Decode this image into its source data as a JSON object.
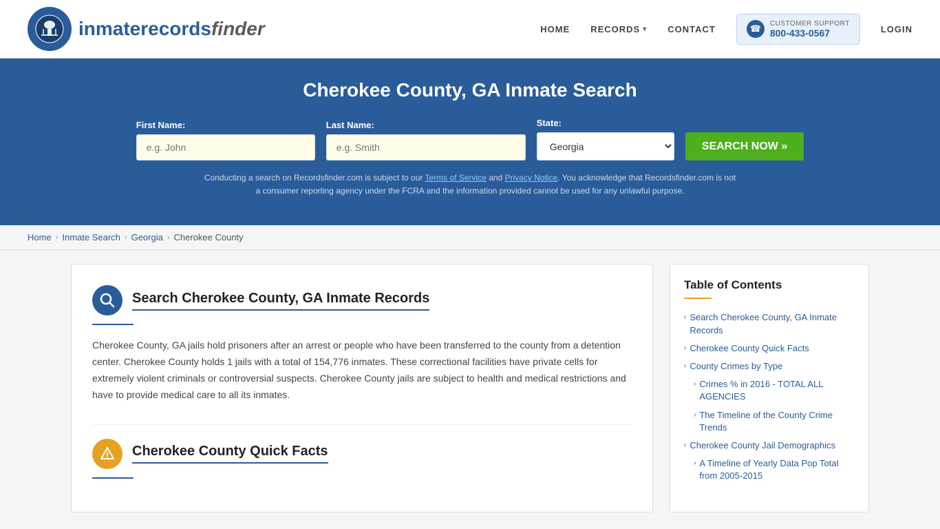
{
  "header": {
    "logo_text_inmate": "inmaterecords",
    "logo_text_finder": "finder",
    "nav": {
      "home": "HOME",
      "records": "RECORDS",
      "contact": "CONTACT",
      "support_label": "CUSTOMER SUPPORT",
      "support_number": "800-433-0567",
      "login": "LOGIN"
    }
  },
  "hero": {
    "title": "Cherokee County, GA Inmate Search",
    "fields": {
      "first_name_label": "First Name:",
      "first_name_placeholder": "e.g. John",
      "last_name_label": "Last Name:",
      "last_name_placeholder": "e.g. Smith",
      "state_label": "State:",
      "state_value": "Georgia",
      "search_button": "SEARCH NOW »"
    },
    "disclaimer": "Conducting a search on Recordsfinder.com is subject to our Terms of Service and Privacy Notice. You acknowledge that Recordsfinder.com is not a consumer reporting agency under the FCRA and the information provided cannot be used for any unlawful purpose."
  },
  "breadcrumb": {
    "home": "Home",
    "inmate_search": "Inmate Search",
    "georgia": "Georgia",
    "current": "Cherokee County"
  },
  "main": {
    "section1": {
      "title": "Search Cherokee County, GA Inmate Records",
      "body": "Cherokee County, GA jails hold prisoners after an arrest or people who have been transferred to the county from a detention center. Cherokee County holds 1 jails with a total of 154,776 inmates. These correctional facilities have private cells for extremely violent criminals or controversial suspects. Cherokee County jails are subject to health and medical restrictions and have to provide medical care to all its inmates."
    },
    "section2": {
      "title": "Cherokee County Quick Facts"
    }
  },
  "toc": {
    "title": "Table of Contents",
    "items": [
      {
        "label": "Search Cherokee County, GA Inmate Records",
        "sub": false
      },
      {
        "label": "Cherokee County Quick Facts",
        "sub": false
      },
      {
        "label": "County Crimes by Type",
        "sub": false
      },
      {
        "label": "Crimes % in 2016 - TOTAL ALL AGENCIES",
        "sub": true
      },
      {
        "label": "The Timeline of the County Crime Trends",
        "sub": true
      },
      {
        "label": "Cherokee County Jail Demographics",
        "sub": false
      },
      {
        "label": "A Timeline of Yearly Data Pop Total from 2005-2015",
        "sub": true
      }
    ]
  }
}
